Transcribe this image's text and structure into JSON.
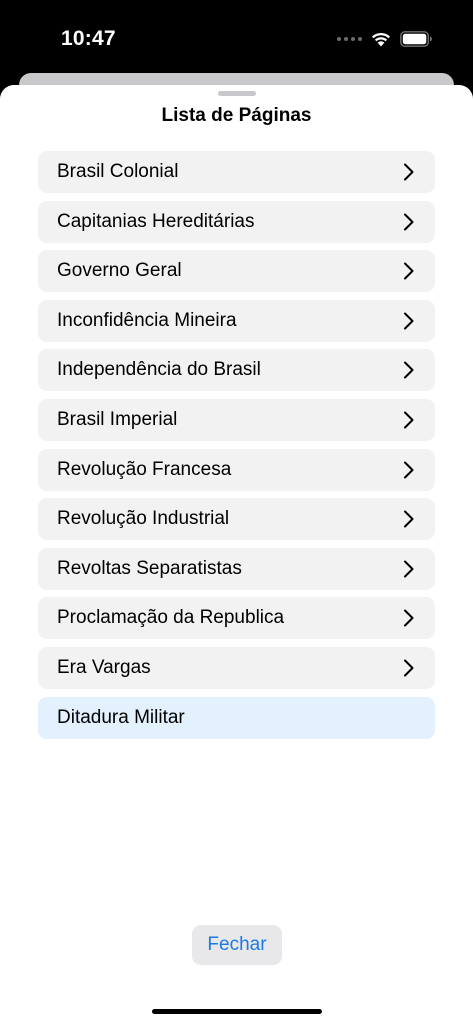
{
  "status_bar": {
    "time": "10:47",
    "icons": [
      "signal-dots-icon",
      "wifi-icon",
      "battery-icon"
    ]
  },
  "sheet": {
    "title": "Lista de Páginas",
    "close_label": "Fechar"
  },
  "pages": [
    {
      "label": "Brasil Colonial",
      "chevron": true,
      "selected": false
    },
    {
      "label": "Capitanias Hereditárias",
      "chevron": true,
      "selected": false
    },
    {
      "label": "Governo Geral",
      "chevron": true,
      "selected": false
    },
    {
      "label": "Inconfidência Mineira",
      "chevron": true,
      "selected": false
    },
    {
      "label": "Independência do Brasil",
      "chevron": true,
      "selected": false
    },
    {
      "label": "Brasil Imperial",
      "chevron": true,
      "selected": false
    },
    {
      "label": "Revolução Francesa",
      "chevron": true,
      "selected": false
    },
    {
      "label": "Revolução Industrial",
      "chevron": true,
      "selected": false
    },
    {
      "label": "Revoltas Separatistas",
      "chevron": true,
      "selected": false
    },
    {
      "label": "Proclamação da Republica",
      "chevron": true,
      "selected": false
    },
    {
      "label": "Era Vargas",
      "chevron": true,
      "selected": false
    },
    {
      "label": "Ditadura Militar",
      "chevron": false,
      "selected": true
    }
  ],
  "colors": {
    "accent": "#1a7ae8",
    "row_background": "#f2f2f2",
    "selected_row_background": "#e3f0fd"
  }
}
